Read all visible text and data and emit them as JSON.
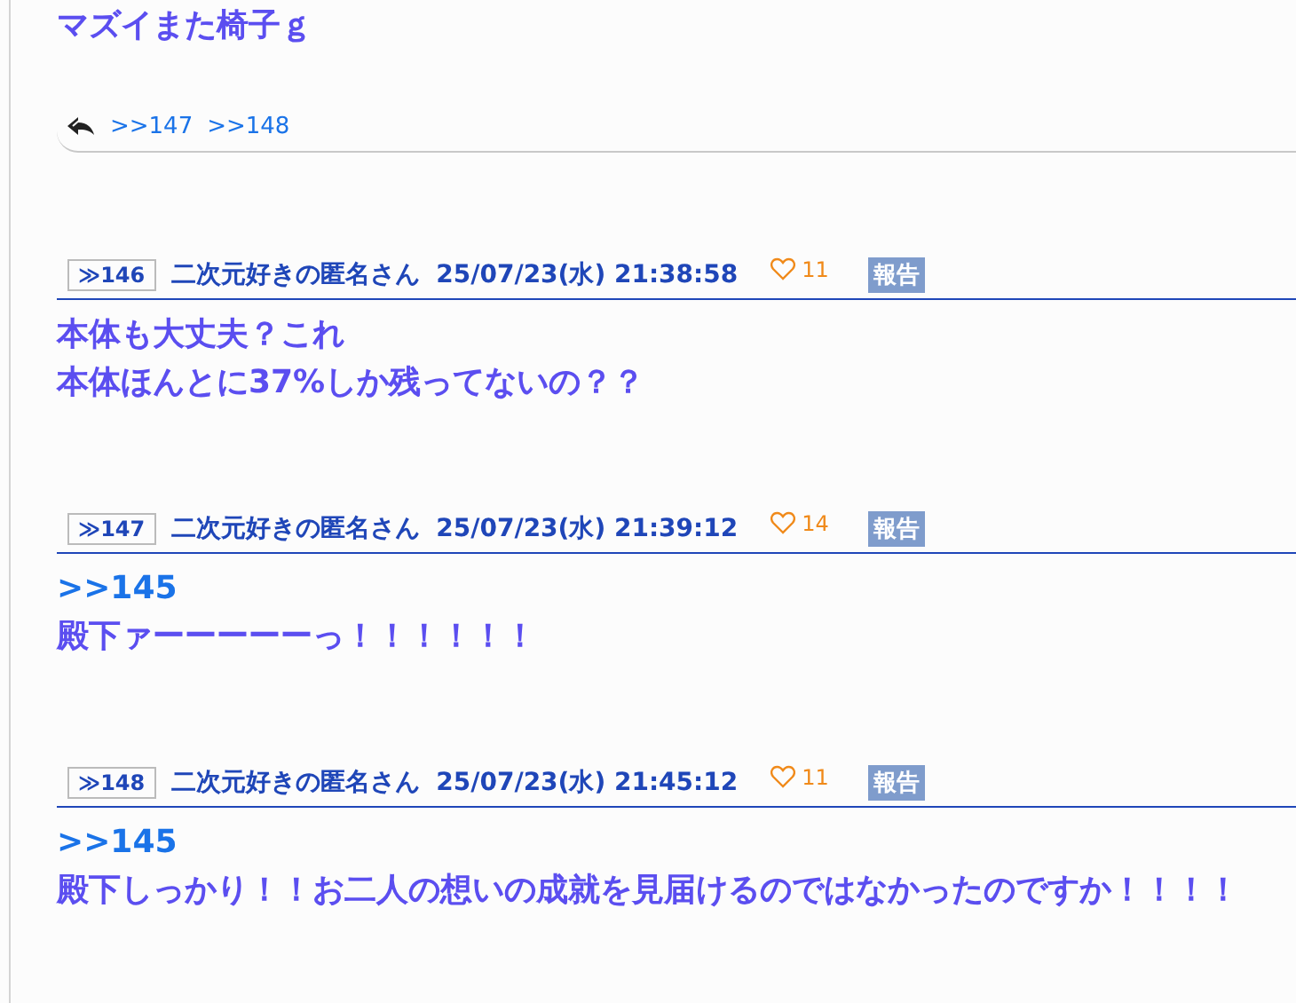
{
  "previous_post": {
    "body": [
      {
        "kind": "text",
        "text": "マズイまた椅子ｇ"
      }
    ],
    "replies": [
      ">>147",
      ">>148"
    ]
  },
  "posts": [
    {
      "number": "≫146",
      "name": "二次元好きの匿名さん",
      "date": "25/07/23(水) 21:38:58",
      "likes": "11",
      "report": "報告",
      "body": [
        {
          "kind": "text",
          "text": "本体も大丈夫？これ"
        },
        {
          "kind": "text",
          "text": "本体ほんとに37%しか残ってないの？？"
        }
      ]
    },
    {
      "number": "≫147",
      "name": "二次元好きの匿名さん",
      "date": "25/07/23(水) 21:39:12",
      "likes": "14",
      "report": "報告",
      "body": [
        {
          "kind": "anchor",
          "text": ">>145"
        },
        {
          "kind": "text",
          "text": "殿下ァーーーーーっ！！！！！！"
        }
      ]
    },
    {
      "number": "≫148",
      "name": "二次元好きの匿名さん",
      "date": "25/07/23(水) 21:45:12",
      "likes": "11",
      "report": "報告",
      "body": [
        {
          "kind": "anchor",
          "text": ">>145"
        },
        {
          "kind": "text",
          "text": "殿下しっかり！！お二人の想いの成就を見届けるのではなかったのですか！！！！"
        }
      ]
    }
  ]
}
